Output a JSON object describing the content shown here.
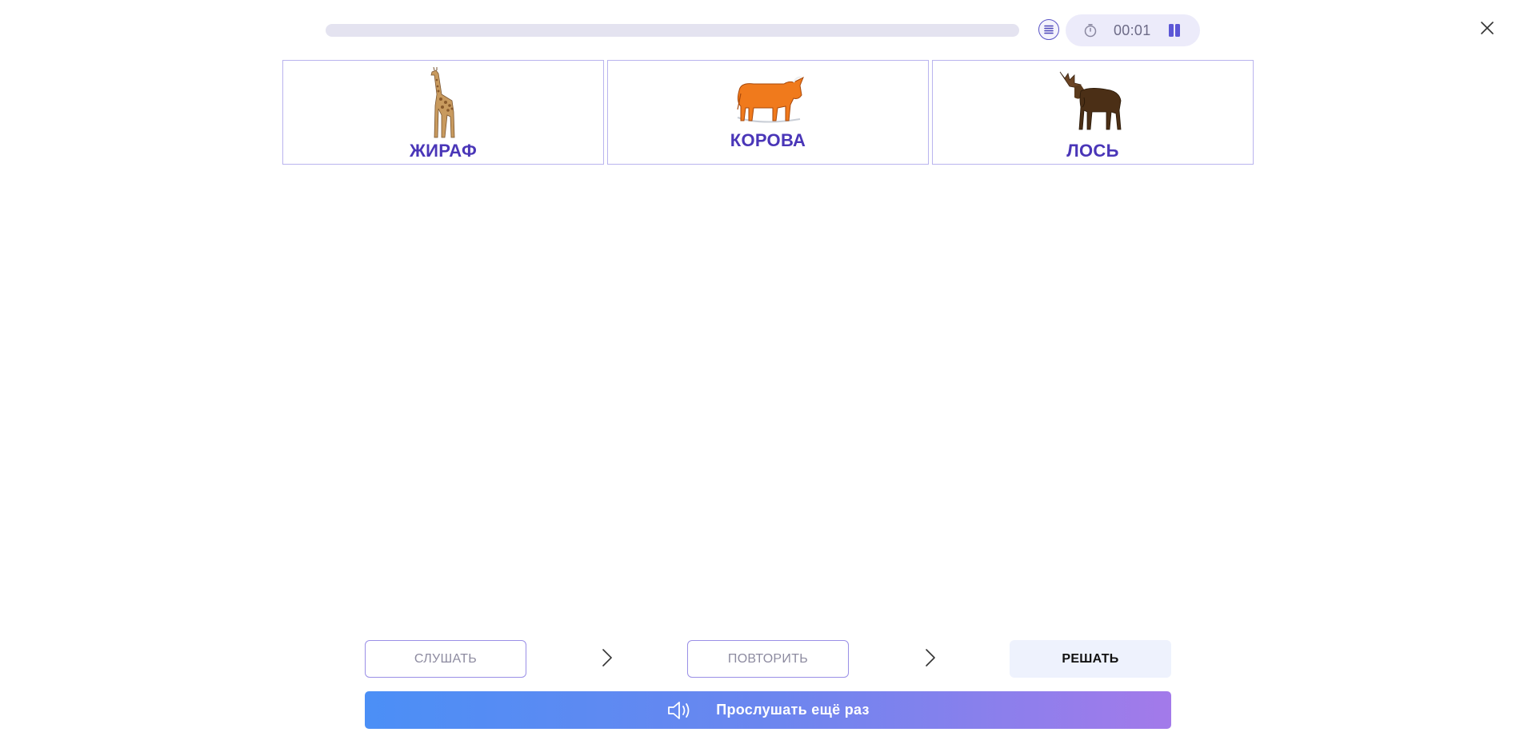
{
  "timer": {
    "time": "00:01"
  },
  "progress": {
    "value": 0
  },
  "cards": [
    {
      "label": "ЖИРАФ",
      "image": "giraffe"
    },
    {
      "label": "КОРОВА",
      "image": "cow"
    },
    {
      "label": "ЛОСЬ",
      "image": "moose"
    }
  ],
  "steps": {
    "listen": "СЛУШАТЬ",
    "repeat": "ПОВТОРИТЬ",
    "solve": "РЕШАТЬ"
  },
  "listen_again": {
    "label": "Прослушать ещё раз",
    "icon": "speaker-icon"
  },
  "colors": {
    "accent": "#4a36b8",
    "card_border": "#b9b4ee",
    "gradient_start": "#4b8ff6",
    "gradient_end": "#a37aea"
  }
}
